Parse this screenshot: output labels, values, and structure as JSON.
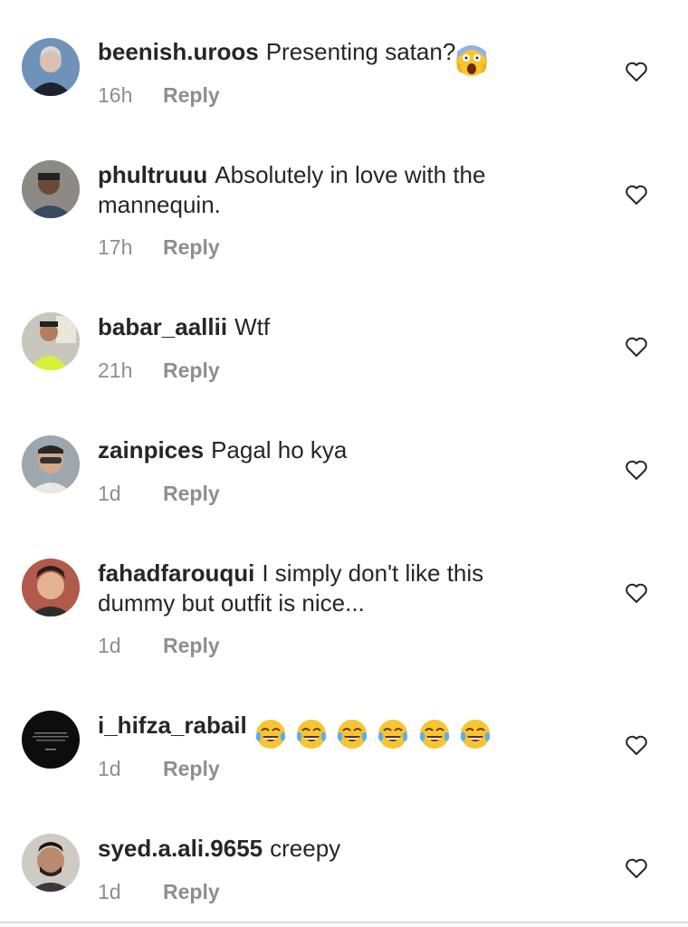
{
  "comments": [
    {
      "username": "beenish.uroos",
      "text": "Presenting satan?",
      "emoji": "scream",
      "time": "16h",
      "reply": "Reply"
    },
    {
      "username": "phultruuu",
      "text": "Absolutely in love with the",
      "text2": "mannequin.",
      "time": "17h",
      "reply": "Reply"
    },
    {
      "username": "babar_aallii",
      "text": "Wtf",
      "time": "21h",
      "reply": "Reply"
    },
    {
      "username": "zainpices",
      "text": "Pagal ho kya",
      "time": "1d",
      "reply": "Reply"
    },
    {
      "username": "fahadfarouqui",
      "text": "I simply don't like this",
      "text2": "dummy but outfit is nice...",
      "time": "1d",
      "reply": "Reply"
    },
    {
      "username": "i_hifza_rabail",
      "text": "",
      "emoji": "tears-of-joy x6",
      "time": "1d",
      "reply": "Reply"
    },
    {
      "username": "syed.a.ali.9655",
      "text": "creepy",
      "time": "1d",
      "reply": "Reply"
    }
  ],
  "icons": {
    "like": "heart-outline-icon",
    "scream": "face-screaming-emoji",
    "joy": "face-with-tears-of-joy-emoji"
  },
  "colors": {
    "text": "#262626",
    "muted": "#8e8e8e",
    "emoji": "#f7c531"
  }
}
